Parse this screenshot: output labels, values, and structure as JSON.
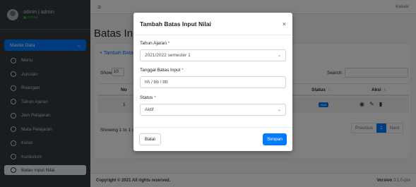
{
  "sidebar": {
    "user": {
      "name": "admin | admin",
      "status": "online"
    },
    "group_label": "Master Data",
    "items": [
      {
        "label": "Menu"
      },
      {
        "label": "Jurusan"
      },
      {
        "label": "Ruangan"
      },
      {
        "label": "Tahun Ajaran"
      },
      {
        "label": "Jam Pelajaran"
      },
      {
        "label": "Mata Pelajaran"
      },
      {
        "label": "Kelas"
      },
      {
        "label": "Kurikulum"
      },
      {
        "label": "Batas Input Nilai"
      }
    ]
  },
  "navbar": {
    "logout_label": "Keluar"
  },
  "page": {
    "title": "Batas Input Nilai",
    "add_button": "+ Tambah Batas Input Nilai",
    "show_label": "Show",
    "show_value": "10",
    "search_label": "Search:",
    "columns": {
      "no": "No",
      "status": "Status",
      "aksi": "Aksi"
    },
    "row": {
      "no": "1",
      "status": "Aktif"
    },
    "showing_text": "Showing 1 to 1 of 1 entries",
    "pagination": {
      "previous": "Previous",
      "current": "1",
      "next": "Next"
    }
  },
  "footer": {
    "copyright": "Copyright © 2021 All rights reserved.",
    "version_label": "Version",
    "version_value": "3.1.0-pre"
  },
  "modal": {
    "title": "Tambah Batas Input Nilai",
    "tahun_label": "Tahun Ajaran",
    "tahun_value": "2021/2022 semester 1",
    "tanggal_label": "Tanggal Batas Input",
    "tanggal_placeholder": "hh / bb / tttt",
    "status_label": "Status",
    "status_value": "Aktif",
    "cancel_label": "Batal",
    "save_label": "Simpan",
    "required_mark": "*"
  },
  "colors": {
    "primary": "#007bff",
    "sidebar": "#343a40",
    "required": "#dc3545"
  }
}
